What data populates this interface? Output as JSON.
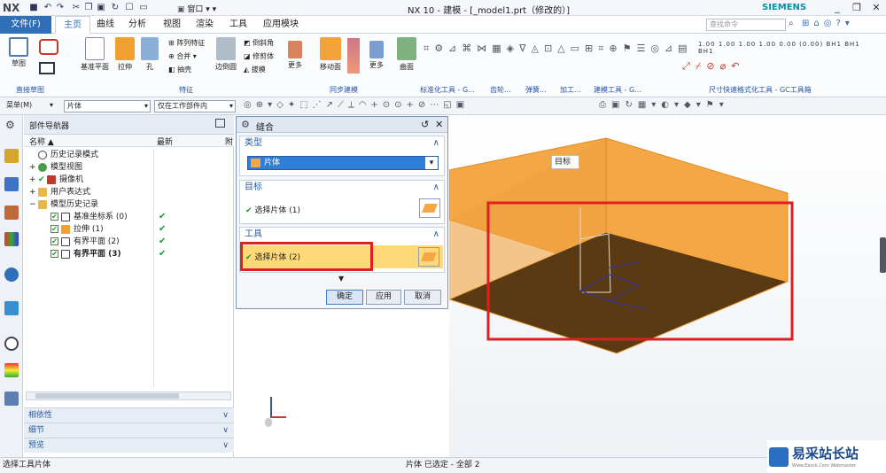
{
  "titlebar": {
    "logo": "NX",
    "window_menu": "窗口",
    "title": "NX 10 - 建模 - [_model1.prt（修改的）]",
    "brand": "SIEMENS"
  },
  "tabs": {
    "file": "文件(F)",
    "items": [
      "主页",
      "曲线",
      "分析",
      "视图",
      "渲染",
      "工具",
      "应用模块"
    ],
    "search_placeholder": "查找命令"
  },
  "ribbon": {
    "buttons": {
      "sketch": "草图",
      "datum_plane": "基准平面",
      "extrude": "拉伸",
      "hole": "孔",
      "pattern_feature": "阵列特征",
      "unite": "合并",
      "shell": "抽壳",
      "edge_blend": "边倒圆",
      "chamfer": "倒斜角",
      "trim_body": "修剪体",
      "draft": "拔模",
      "more1": "更多",
      "move_face": "移动面",
      "more2": "更多",
      "surface": "曲面"
    },
    "groups": [
      "直接草图",
      "特征",
      "同步建模",
      "标准化工具 - G...",
      "齿轮...",
      "弹簧...",
      "加工...",
      "建模工具 - G...",
      "尺寸快速格式化工具 - GC工具箱"
    ],
    "dim_labels": [
      "1.00",
      "1.00",
      "1.00",
      "1.00",
      "0.00",
      "(0.00)",
      "BH1",
      "BH1",
      "BH1"
    ]
  },
  "cmdbar": {
    "menu": "菜单(M)",
    "filter": "片体",
    "scope": "仅在工作部件内"
  },
  "navigator": {
    "title": "部件导航器",
    "col_name": "名称",
    "col_latest": "最新",
    "col_extra": "附",
    "rows": [
      {
        "label": "历史记录模式",
        "check": ""
      },
      {
        "label": "模型视图",
        "check": ""
      },
      {
        "label": "摄像机",
        "check": ""
      },
      {
        "label": "用户表达式",
        "check": ""
      },
      {
        "label": "模型历史记录",
        "check": ""
      },
      {
        "label": "基准坐标系 (0)",
        "check": "✔"
      },
      {
        "label": "拉伸 (1)",
        "check": "✔"
      },
      {
        "label": "有界平面 (2)",
        "check": "✔"
      },
      {
        "label": "有界平面 (3)",
        "check": "✔"
      }
    ],
    "accordion": [
      "相依性",
      "细节",
      "预览"
    ]
  },
  "dialog": {
    "title": "缝合",
    "type_label": "类型",
    "type_value": "片体",
    "target_label": "目标",
    "target_select": "选择片体 (1)",
    "tool_label": "工具",
    "tool_select": "选择片体 (2)",
    "ok": "确定",
    "apply": "应用",
    "cancel": "取消"
  },
  "viewport": {
    "tooltip": "目标"
  },
  "status": {
    "left": "选择工具片体",
    "center": "片体 已选定 - 全部 2"
  },
  "watermark": {
    "text": "易采站长站",
    "sub": "Www.Easck.Com Webmaster"
  },
  "colors": {
    "accent": "#2f6fb8",
    "highlight": "#ffd978",
    "red_box": "#e02020",
    "orange": "#f5a645",
    "dark": "#5a3a12"
  }
}
